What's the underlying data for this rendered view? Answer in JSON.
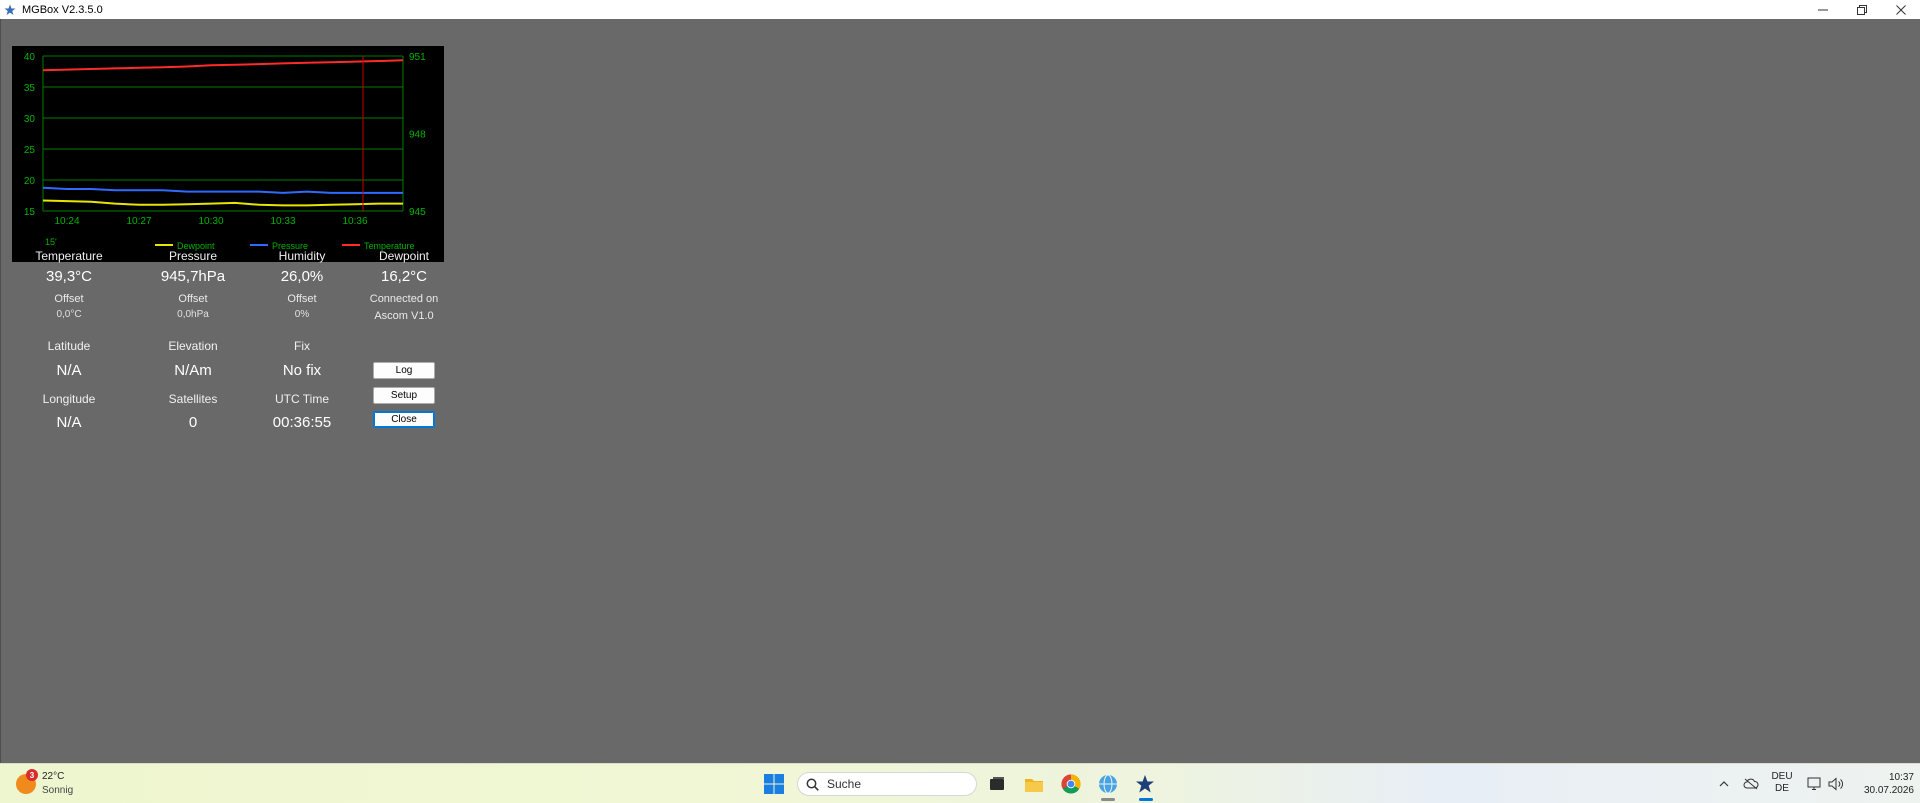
{
  "window": {
    "title": "MGBox V2.3.5.0",
    "controls": [
      "minimize",
      "restore",
      "close"
    ]
  },
  "chart": {
    "time_window_label": "15'",
    "colors": {
      "background": "#000000",
      "grid": "#007d00",
      "text": "#00b300",
      "dewpoint": "#e6e600",
      "pressure": "#2f6bff",
      "temperature": "#ff2a2a",
      "cursor": "#cc0000"
    }
  },
  "chart_data": {
    "type": "line",
    "x_tick_labels": [
      "10:24",
      "10:27",
      "10:30",
      "10:33",
      "10:36"
    ],
    "y_left": {
      "ticks": [
        15,
        20,
        25,
        30,
        35,
        40
      ],
      "range": [
        15,
        40
      ]
    },
    "y_right": {
      "ticks": [
        945,
        948,
        951
      ],
      "range": [
        945,
        951
      ]
    },
    "legend": [
      "Dewpoint",
      "Pressure",
      "Temperature"
    ],
    "legend_placement": "bottom",
    "grid": true,
    "x": [
      "10:23",
      "10:24",
      "10:25",
      "10:26",
      "10:27",
      "10:28",
      "10:29",
      "10:30",
      "10:31",
      "10:32",
      "10:33",
      "10:34",
      "10:35",
      "10:36",
      "10:37",
      "10:38"
    ],
    "series": [
      {
        "name": "Temperature",
        "axis": "left",
        "values": [
          37.7,
          37.8,
          37.9,
          38.0,
          38.1,
          38.2,
          38.3,
          38.5,
          38.6,
          38.7,
          38.8,
          38.9,
          39.0,
          39.1,
          39.2,
          39.3
        ]
      },
      {
        "name": "Pressure",
        "axis": "right",
        "values": [
          945.9,
          945.85,
          945.85,
          945.8,
          945.8,
          945.8,
          945.75,
          945.75,
          945.75,
          945.75,
          945.7,
          945.75,
          945.7,
          945.7,
          945.7,
          945.7
        ]
      },
      {
        "name": "Dewpoint",
        "axis": "left",
        "values": [
          16.7,
          16.6,
          16.5,
          16.2,
          16.0,
          16.0,
          16.1,
          16.2,
          16.3,
          16.0,
          15.9,
          15.9,
          16.0,
          16.1,
          16.2,
          16.2
        ]
      }
    ],
    "cursor_time": "10:36"
  },
  "readings": {
    "temperature": {
      "label": "Temperature",
      "value": "39,3°C",
      "offset_label": "Offset",
      "offset": "0,0°C"
    },
    "pressure": {
      "label": "Pressure",
      "value": "945,7hPa",
      "offset_label": "Offset",
      "offset": "0,0hPa"
    },
    "humidity": {
      "label": "Humidity",
      "value": "26,0%",
      "offset_label": "Offset",
      "offset": "0%"
    },
    "dewpoint": {
      "label": "Dewpoint",
      "value": "16,2°C",
      "conn_line1": "Connected on",
      "conn_line2": "Ascom V1.0"
    },
    "latitude": {
      "label": "Latitude",
      "value": "N/A"
    },
    "elevation": {
      "label": "Elevation",
      "value": "N/Am"
    },
    "fix": {
      "label": "Fix",
      "value": "No fix"
    },
    "longitude": {
      "label": "Longitude",
      "value": "N/A"
    },
    "satellites": {
      "label": "Satellites",
      "value": "0"
    },
    "utc": {
      "label": "UTC Time",
      "value": "00:36:55"
    }
  },
  "buttons": {
    "log": "Log",
    "setup": "Setup",
    "close": "Close"
  },
  "taskbar": {
    "weather_badge": "3",
    "weather_temp": "22°C",
    "weather_desc": "Sonnig",
    "search_placeholder": "Suche",
    "lang_line1": "DEU",
    "lang_line2": "DE",
    "time": "10:37",
    "date": "30.07.2026"
  }
}
